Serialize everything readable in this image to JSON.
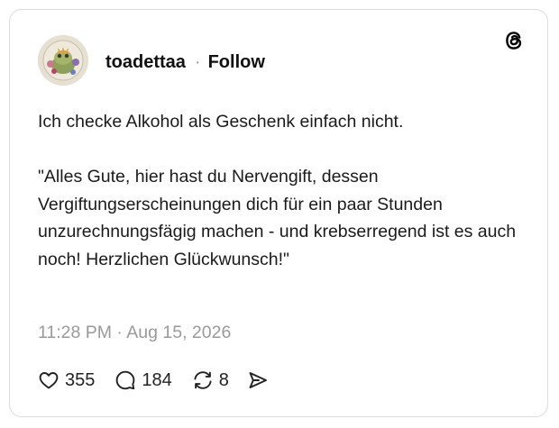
{
  "post": {
    "username": "toadettaa",
    "separator": "·",
    "follow_label": "Follow",
    "paragraphs": [
      "Ich checke Alkohol als Geschenk einfach nicht.",
      "\"Alles Gute, hier hast du Nervengift, dessen Vergiftungserscheinungen dich für ein paar Stunden unzurechnungsfägig machen - und krebserregend ist es auch noch! Herzlichen Glückwunsch!\""
    ],
    "timestamp": "11:28 PM · Aug 15, 2026"
  },
  "actions": {
    "likes": "355",
    "replies": "184",
    "reposts": "8"
  },
  "icons": {
    "brand": "threads-logo-icon",
    "like": "heart-icon",
    "reply": "speech-bubble-icon",
    "repost": "repost-icon",
    "share": "send-icon"
  },
  "colors": {
    "text": "#1a1a1a",
    "muted": "#9a9a9a",
    "border": "#dcdcdc"
  }
}
